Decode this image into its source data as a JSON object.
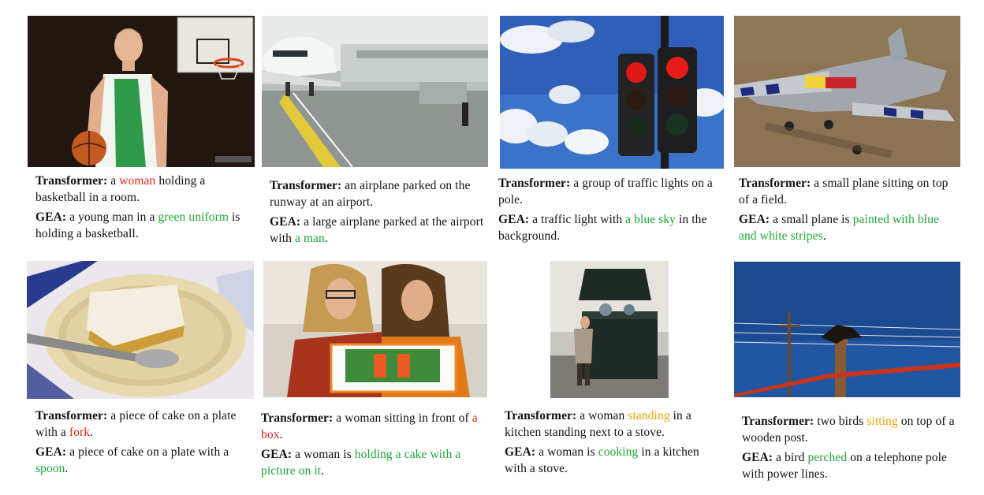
{
  "colors": {
    "red": "#e0281c",
    "green": "#1fa53a",
    "orange": "#e8a300"
  },
  "panels": [
    {
      "image": "basketball-player-photo",
      "t_label": "Transformer:",
      "t": [
        {
          "text": " a "
        },
        {
          "text": "woman",
          "c": "red"
        },
        {
          "text": " holding a basketball in a room."
        }
      ],
      "g_label": "GEA:",
      "g": [
        {
          "text": " a young man in a "
        },
        {
          "text": "green uniform",
          "c": "green"
        },
        {
          "text": " is holding a basketball."
        }
      ]
    },
    {
      "image": "airplane-at-gate-photo",
      "t_label": "Transformer:",
      "t": [
        {
          "text": " an airplane parked on the runway at an airport."
        }
      ],
      "g_label": "GEA:",
      "g": [
        {
          "text": " a large airplane parked at the airport with "
        },
        {
          "text": "a man",
          "c": "green"
        },
        {
          "text": "."
        }
      ]
    },
    {
      "image": "traffic-lights-photo",
      "t_label": "Transformer:",
      "t": [
        {
          "text": " a group of traffic lights on a pole."
        }
      ],
      "g_label": "GEA:",
      "g": [
        {
          "text": " a traffic light with "
        },
        {
          "text": "a blue sky",
          "c": "green"
        },
        {
          "text": " in the background."
        }
      ]
    },
    {
      "image": "small-plane-photo",
      "t_label": "Transformer:",
      "t": [
        {
          "text": " a small plane sitting on top of a field."
        }
      ],
      "g_label": "GEA:",
      "g": [
        {
          "text": " a small plane is "
        },
        {
          "text": "painted with blue and white stripes",
          "c": "green"
        },
        {
          "text": "."
        }
      ]
    },
    {
      "image": "cake-on-plate-photo",
      "t_label": "Transformer:",
      "t": [
        {
          "text": " a piece of cake on a plate with a "
        },
        {
          "text": "fork",
          "c": "red"
        },
        {
          "text": "."
        }
      ],
      "g_label": "GEA:",
      "g": [
        {
          "text": " a piece of cake on a plate with a "
        },
        {
          "text": "spoon",
          "c": "green"
        },
        {
          "text": "."
        }
      ]
    },
    {
      "image": "two-women-with-cake-photo",
      "t_label": "Transformer:",
      "t": [
        {
          "text": " a woman sitting in front of "
        },
        {
          "text": "a box",
          "c": "red"
        },
        {
          "text": "."
        }
      ],
      "g_label": "GEA:",
      "g": [
        {
          "text": " a woman is "
        },
        {
          "text": "holding a cake with a picture on it",
          "c": "green"
        },
        {
          "text": "."
        }
      ]
    },
    {
      "image": "woman-at-stove-photo",
      "t_label": "Transformer:",
      "t": [
        {
          "text": " a woman "
        },
        {
          "text": "standing",
          "c": "orange"
        },
        {
          "text": " in a kitchen standing next to a stove."
        }
      ],
      "g_label": "GEA:",
      "g": [
        {
          "text": " a woman is "
        },
        {
          "text": "cooking",
          "c": "green"
        },
        {
          "text": " in a kitchen with a stove."
        }
      ]
    },
    {
      "image": "bird-on-post-photo",
      "t_label": "Transformer:",
      "t": [
        {
          "text": " two birds "
        },
        {
          "text": "sitting",
          "c": "orange"
        },
        {
          "text": " on top of a wooden post."
        }
      ],
      "g_label": "GEA:",
      "g": [
        {
          "text": " a bird "
        },
        {
          "text": "perched",
          "c": "green"
        },
        {
          "text": " on a telephone pole with power lines."
        }
      ]
    }
  ]
}
